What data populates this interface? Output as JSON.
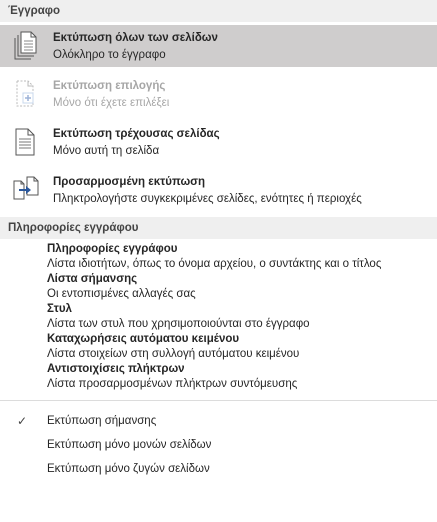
{
  "doc_section": {
    "header": "Έγγραφο",
    "items": [
      {
        "title": "Εκτύπωση όλων των σελίδων",
        "desc": "Ολόκληρο το έγγραφο",
        "icon": "all-pages-icon",
        "selected": true,
        "disabled": false
      },
      {
        "title": "Εκτύπωση επιλογής",
        "desc": "Μόνο ότι έχετε επιλέξει",
        "icon": "selection-page-icon",
        "selected": false,
        "disabled": true
      },
      {
        "title": "Εκτύπωση τρέχουσας σελίδας",
        "desc": "Μόνο αυτή τη σελίδα",
        "icon": "current-page-icon",
        "selected": false,
        "disabled": false
      },
      {
        "title": "Προσαρμοσμένη εκτύπωση",
        "desc": "Πληκτρολογήστε συγκεκριμένες σελίδες, ενότητες ή περιοχές",
        "icon": "custom-print-icon",
        "selected": false,
        "disabled": false
      }
    ]
  },
  "info_section": {
    "header": "Πληροφορίες εγγράφου",
    "items": [
      {
        "title": "Πληροφορίες εγγράφου",
        "desc": "Λίστα ιδιοτήτων, όπως το όνομα αρχείου, ο συντάκτης και ο τίτλος"
      },
      {
        "title": "Λίστα σήμανσης",
        "desc": "Οι εντοπισμένες αλλαγές σας"
      },
      {
        "title": "Στυλ",
        "desc": "Λίστα των στυλ που χρησιμοποιούνται στο έγγραφο"
      },
      {
        "title": "Καταχωρήσεις αυτόματου κειμένου",
        "desc": "Λίστα στοιχείων στη συλλογή αυτόματου κειμένου"
      },
      {
        "title": "Αντιστοιχίσεις πλήκτρων",
        "desc": "Λίστα προσαρμοσμένων πλήκτρων συντόμευσης"
      }
    ]
  },
  "options": [
    {
      "label": "Εκτύπωση σήμανσης",
      "checked": true,
      "check_glyph": "✓"
    },
    {
      "label": "Εκτύπωση  μόνο μονών σελίδων",
      "checked": false,
      "check_glyph": ""
    },
    {
      "label": "Εκτύπωση μόνο ζυγών σελίδων",
      "checked": false,
      "check_glyph": ""
    }
  ],
  "colors": {
    "selected_bg": "#cfcdcd",
    "header_bg": "#efefef",
    "disabled_text": "#a6a6a6",
    "accent_blue": "#2b579a"
  }
}
